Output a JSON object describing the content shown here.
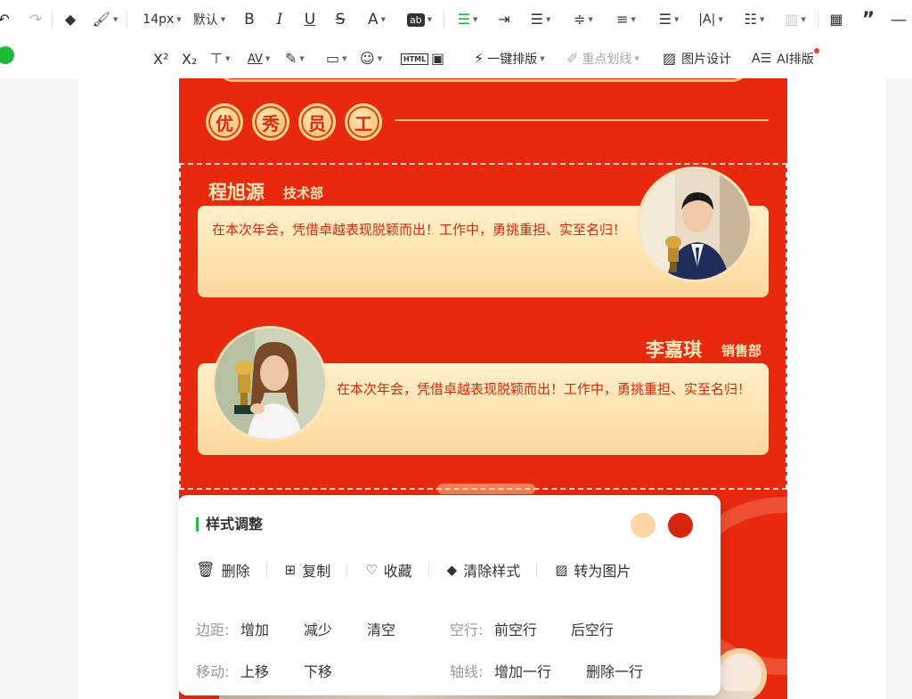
{
  "toolbar": {
    "font_size": "14px",
    "font_family": "默认",
    "one_key_layout": "一键排版",
    "highlight_underline": "重点划线",
    "image_design": "图片设计",
    "ai_layout": "AI排版"
  },
  "poster": {
    "title_chars": [
      "优",
      "秀",
      "员",
      "工"
    ],
    "employee1": {
      "name": "程旭源",
      "dept": "技术部",
      "text": "在本次年会，凭借卓越表现脱颖而出！工作中，勇挑重担、实至名归！"
    },
    "employee2": {
      "name": "李嘉琪",
      "dept": "销售部",
      "text": "在本次年会，凭借卓越表现脱颖而出！工作中，勇挑重担、实至名归！"
    }
  },
  "popup": {
    "title": "样式调整",
    "swatches": [
      "#fdd6a4",
      "#d8260d"
    ],
    "actions": [
      "删除",
      "复制",
      "收藏",
      "清除样式",
      "转为图片"
    ],
    "margin_label": "边距:",
    "margin_actions": [
      "增加",
      "减少",
      "清空"
    ],
    "blank_line_label": "空行:",
    "blank_line_actions": [
      "前空行",
      "后空行"
    ],
    "move_label": "移动:",
    "move_actions": [
      "上移",
      "下移"
    ],
    "axis_label": "轴线:",
    "axis_actions": [
      "增加一行",
      "删除一行"
    ]
  },
  "colors": {
    "poster_red": "#e8290f",
    "gold": "#f7c873",
    "accent_green": "#2db84d"
  }
}
